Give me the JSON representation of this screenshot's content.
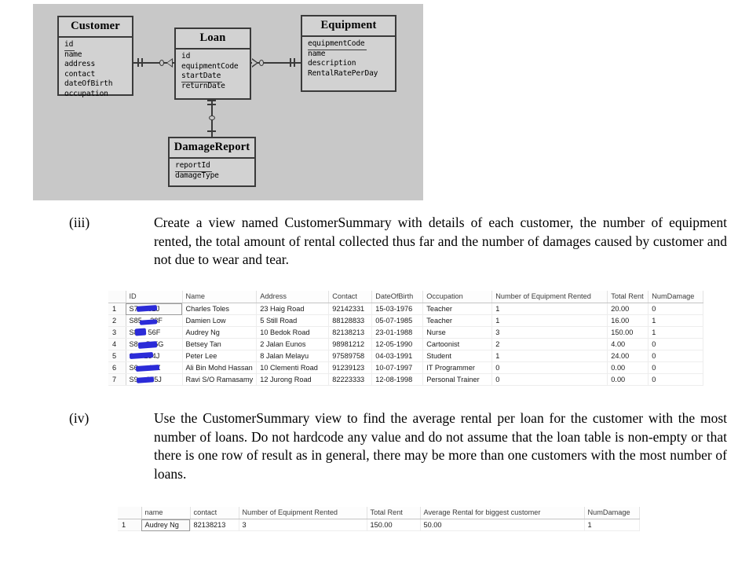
{
  "er_diagram": {
    "background_color": "#c8c8c8",
    "entities": [
      {
        "name": "Customer",
        "attributes": [
          "id",
          "name",
          "address",
          "contact",
          "dateOfBirth",
          "occupation"
        ],
        "primary_key": "id"
      },
      {
        "name": "Loan",
        "attributes": [
          "id",
          "equipmentCode",
          "startDate",
          "returnDate"
        ],
        "primary_key": "id, equipmentCode, startDate"
      },
      {
        "name": "Equipment",
        "attributes": [
          "equipmentCode",
          "name",
          "description",
          "RentalRatePerDay"
        ],
        "primary_key": "equipmentCode"
      },
      {
        "name": "DamageReport",
        "attributes": [
          "reportId",
          "damageType"
        ],
        "primary_key": "reportId"
      }
    ],
    "relationships": [
      {
        "from": "Customer",
        "to": "Loan",
        "from_cardinality": "one-and-only-one",
        "to_cardinality": "zero-or-many"
      },
      {
        "from": "Loan",
        "to": "Equipment",
        "from_cardinality": "zero-or-many",
        "to_cardinality": "one-and-only-one"
      },
      {
        "from": "Loan",
        "to": "DamageReport",
        "from_cardinality": "one-and-only-one",
        "to_cardinality": "zero-or-one"
      }
    ]
  },
  "question_iii": {
    "label": "(iii)",
    "text": "Create a view named CustomerSummary with details of each customer, the number of equipment rented, the total amount of rental collected thus far and the number of damages caused by customer and not due to wear and tear."
  },
  "question_iv": {
    "label": "(iv)",
    "text": "Use the CustomerSummary view to find the average rental per loan for the customer with the most number of loans. Do not hardcode any value and do not assume that the loan table is non-empty or that there is one row of result as in general, there may be more than one customers with the most number of loans."
  },
  "customer_summary_table": {
    "columns": [
      "",
      "ID",
      "Name",
      "Address",
      "Contact",
      "DateOfBirth",
      "Occupation",
      "Number of Equipment Rented",
      "Total Rent",
      "NumDamage"
    ],
    "rows": [
      {
        "n": "1",
        "id_prefix": "S7",
        "id_suffix": "82J",
        "name": "Charles Toles",
        "address": "23 Haig Road",
        "contact": "92142331",
        "dob": "15-03-1976",
        "occupation": "Teacher",
        "num_equipment": "1",
        "total_rent": "20.00",
        "num_damage": "0"
      },
      {
        "n": "2",
        "id_prefix": "S85",
        "id_suffix": "23F",
        "name": "Damien Low",
        "address": "5 Still Road",
        "contact": "88128833",
        "dob": "05-07-1985",
        "occupation": "Teacher",
        "num_equipment": "1",
        "total_rent": "16.00",
        "num_damage": "1"
      },
      {
        "n": "3",
        "id_prefix": "S8",
        "id_suffix": "56F",
        "name": "Audrey Ng",
        "address": "10 Bedok Road",
        "contact": "82138213",
        "dob": "23-01-1988",
        "occupation": "Nurse",
        "num_equipment": "3",
        "total_rent": "150.00",
        "num_damage": "1"
      },
      {
        "n": "4",
        "id_prefix": "S8",
        "id_suffix": "545G",
        "name": "Betsey Tan",
        "address": "2 Jalan Eunos",
        "contact": "98981212",
        "dob": "12-05-1990",
        "occupation": "Cartoonist",
        "num_equipment": "2",
        "total_rent": "4.00",
        "num_damage": "0"
      },
      {
        "n": "5",
        "id_prefix": "S9",
        "id_suffix": "234J",
        "name": "Peter Lee",
        "address": "8 Jalan Melayu",
        "contact": "97589758",
        "dob": "04-03-1991",
        "occupation": "Student",
        "num_equipment": "1",
        "total_rent": "24.00",
        "num_damage": "0"
      },
      {
        "n": "6",
        "id_prefix": "S6",
        "id_suffix": "45Z",
        "name": "Ali Bin Mohd Hassan",
        "address": "10 Clementi Road",
        "contact": "91239123",
        "dob": "10-07-1997",
        "occupation": "IT Programmer",
        "num_equipment": "0",
        "total_rent": "0.00",
        "num_damage": "0"
      },
      {
        "n": "7",
        "id_prefix": "S9",
        "id_suffix": "675J",
        "name": "Ravi S/O Ramasamy",
        "address": "12 Jurong Road",
        "contact": "82223333",
        "dob": "12-08-1998",
        "occupation": "Personal Trainer",
        "num_equipment": "0",
        "total_rent": "0.00",
        "num_damage": "0"
      }
    ]
  },
  "avg_rental_table": {
    "columns": [
      "",
      "name",
      "contact",
      "Number of Equipment Rented",
      "Total Rent",
      "Average Rental for biggest customer",
      "NumDamage"
    ],
    "rows": [
      {
        "n": "1",
        "name": "Audrey Ng",
        "contact": "82138213",
        "num_equipment": "3",
        "total_rent": "150.00",
        "avg_rental": "50.00",
        "num_damage": "1"
      }
    ]
  }
}
